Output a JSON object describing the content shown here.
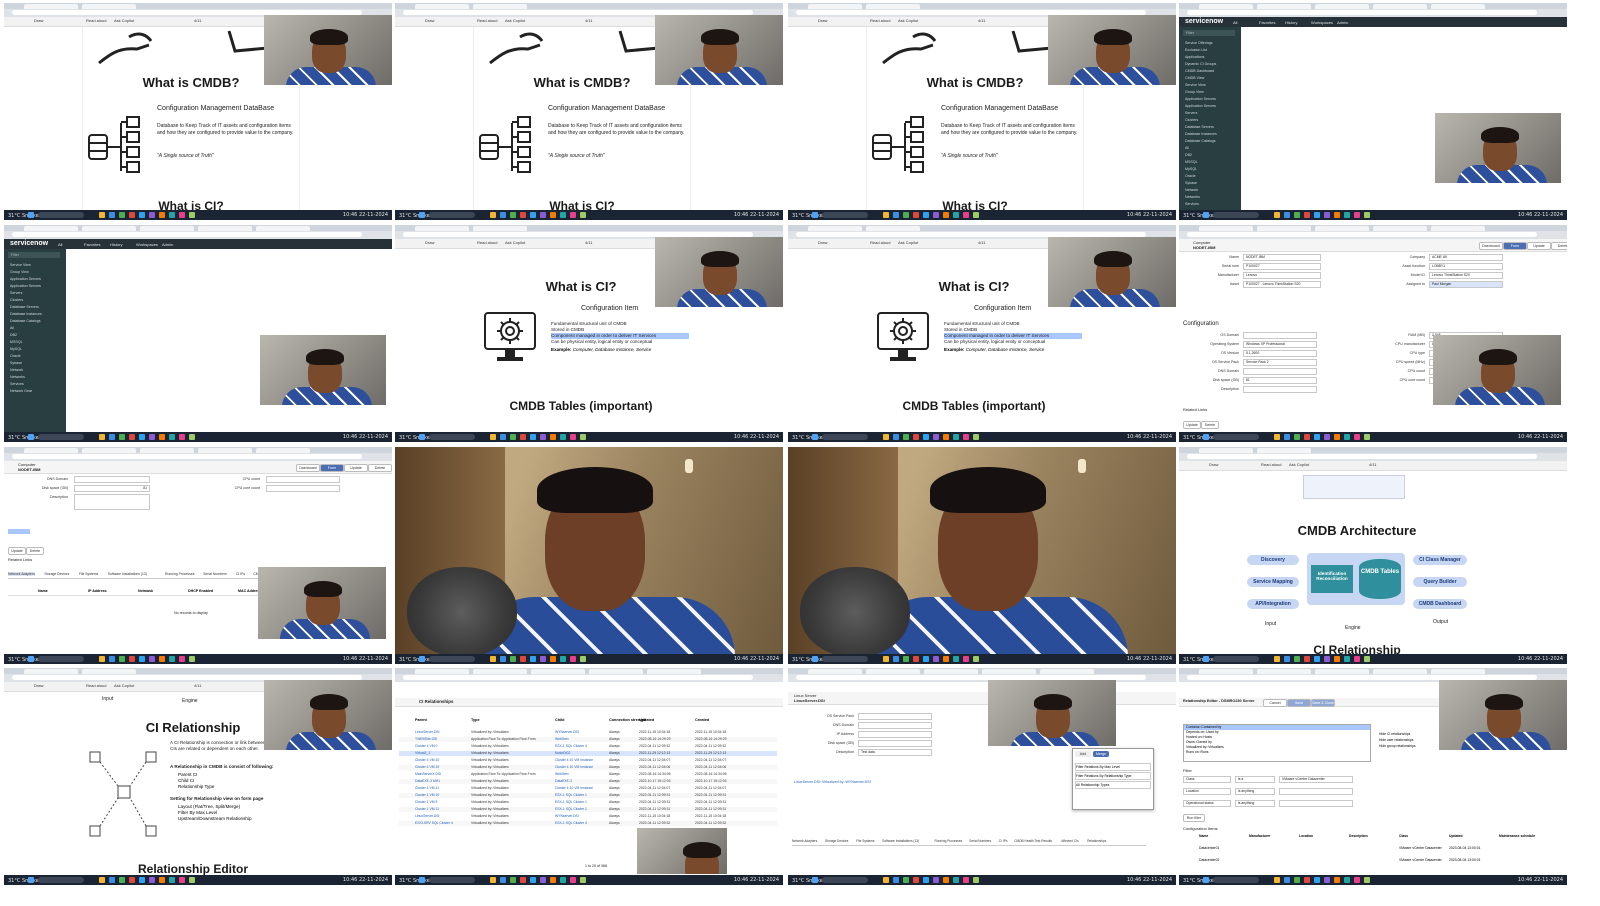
{
  "taskbar": {
    "time": "10:46",
    "date": "22-11-2024",
    "weather": "31°C Smoke",
    "search": "Search"
  },
  "pdf": {
    "ask_copilot": "Ask Copilot",
    "read_aloud": "Read aloud",
    "draw": "Draw",
    "page": "4/11"
  },
  "slides": {
    "cmdb": {
      "title": "What is CMDB?",
      "heading": "Configuration Management DataBase",
      "body": "Database to Keep Track of IT assets and configuration items and how they are configured to provide value to the company.",
      "quote": "\"A Single source of Truth\"",
      "next_title": "What is CI?"
    },
    "ci": {
      "title": "What is CI?",
      "heading": "Configuration Item",
      "bullets": [
        "Fundamental structural unit of CMDB",
        "Stored in CMDB",
        "Component managed in order to deliver IT Services",
        "Can be physical entity, logical entity or conceptual"
      ],
      "example_label": "Example:",
      "example": "Computer, Database Instance, Service",
      "next_title": "CMDB Tables (important)"
    },
    "arch": {
      "title": "CMDB Architecture",
      "left": [
        "Discovery",
        "Service Mapping",
        "API/Integration"
      ],
      "middle": [
        "Identification Reconciliation",
        "CMDB Tables"
      ],
      "right": [
        "CI Class Manager",
        "Query Builder",
        "CMDB Dashboard"
      ],
      "input": "Input",
      "engine": "Engine",
      "output": "Output",
      "next_title": "CI Relationship"
    },
    "rel": {
      "input": "Input",
      "engine": "Engine",
      "title": "CI Relationship",
      "intro": "A CI Relationship is connection or link between CIs. Shows how CIs are related or dependent on each other.",
      "consist_heading": "A Relationship in CMDB is consist of following:",
      "consist": [
        "Parent CI",
        "Child CI",
        "Relationship Type"
      ],
      "setting_heading": "Setting for Relationship view on form page",
      "setting": [
        "Layout (Flat/Tree, Split/Merge)",
        "Filter By Max Level",
        "Upstream/Downstream Relationship"
      ],
      "next_title": "Relationship Editor"
    }
  },
  "servicenow": {
    "logo": "servicenow",
    "menu": [
      "All",
      "Favorites",
      "History",
      "Workspaces",
      "Admin"
    ],
    "filter_placeholder": "Filter",
    "nav_items": [
      "Service Offerings",
      "Exclusion List",
      "Applications",
      "Dynamic CI Groups",
      "CMDB Dashboard",
      "CMDB View",
      "Service View",
      "Group View",
      "Application Servers",
      "Application Servers",
      "Servers",
      "Clusters",
      "Database Servers",
      "Database Instances",
      "Database Catalogs",
      "All",
      "DB2",
      "MSSQL",
      "MySQL",
      "Oracle",
      "Sybase",
      "Network",
      "Networks",
      "Services",
      "Network Gear"
    ],
    "computer_form": {
      "record_type": "Computer",
      "record_name": "NODET-IBM",
      "fields_left": [
        [
          "Name",
          "NODET-IBM"
        ],
        [
          "Serial num",
          "P100027"
        ],
        [
          "Manufacturer",
          "Lenovo"
        ],
        [
          "Asset",
          "P100027 - Lenovo ThinkStation S20"
        ]
      ],
      "fields_right": [
        [
          "Company",
          "ACME UK"
        ],
        [
          "Asset function",
          "LOBBY1"
        ],
        [
          "Model ID",
          "Lenovo ThinkStation S20"
        ],
        [
          "Assigned to",
          "Paul Morgan"
        ]
      ],
      "section": "Configuration",
      "config_left": [
        [
          "OS Domain",
          ""
        ],
        [
          "Operating System",
          "Windows XP Professional"
        ],
        [
          "OS Version",
          "5.1.2600"
        ],
        [
          "OS Service Pack",
          "Service Pack 2"
        ],
        [
          "DNS Domain",
          ""
        ],
        [
          "Disk space (GB)",
          "81"
        ],
        [
          "Description",
          ""
        ]
      ],
      "config_right": [
        [
          "RAM (MB)",
          "2,048"
        ],
        [
          "CPU manufacturer",
          "Intel"
        ],
        [
          "CPU type",
          ""
        ],
        [
          "CPU speed (MHz)",
          ""
        ],
        [
          "CPU count",
          ""
        ],
        [
          "CPU core count",
          ""
        ]
      ],
      "buttons": [
        "Dashboard",
        "Form",
        "Update",
        "Delete"
      ],
      "related": "Related Links",
      "update": "Update",
      "delete": "Delete",
      "tabs": [
        "Network Adapters",
        "Storage Devices",
        "File Systems",
        "Software Installations (13)",
        "Running Processes",
        "Serial Numbers",
        "CI IPs",
        "CMDB Health Test Results",
        "Affected CIs",
        "Relationships"
      ],
      "table_cols": [
        "Name",
        "IP Address",
        "Netmask",
        "DHCP Enabled",
        "MAC Address"
      ],
      "no_records": "No records to display"
    },
    "relationships": {
      "title": "CI Relationships",
      "columns": [
        "Parent",
        "Type",
        "Child",
        "Connection strength",
        "Updated",
        "Created"
      ],
      "rows": [
        [
          "LinuxServer.DSI",
          "Virtualized by::Virtualizes",
          "WYNserver.DSI",
          "Always",
          "2022-11-15 10:04:18",
          "2022-11-15 10:04:18"
        ],
        [
          "TWEBSite.DSI",
          "Application Flow To::Application Flow From",
          "WebServ",
          "Always",
          "2022-08-16 14:29:29",
          "2022-08-16 14:29:29"
        ],
        [
          "Cluster 4 VM 0",
          "Virtualized by::Virtualizes",
          "ESX-1 SQL Cluster 4",
          "Always",
          "2022-04-11 12:09:32",
          "2022-04-11 12:09:32"
        ],
        [
          "Virtual1_1",
          "Virtualized by::Virtualizes",
          "NodeDI02",
          "Always",
          "2022-11-29 12:12:13",
          "2022-11-29 12:12:13"
        ],
        [
          "Cluster 4 VM 10",
          "Virtualized by::Virtualizes",
          "Cluster 4 10 VM Instance",
          "Always",
          "2022-04-11 12:04:07",
          "2022-04-11 12:04:07"
        ],
        [
          "Cluster 4 VM 19",
          "Virtualized by::Virtualizes",
          "Cluster 4 10 VM Instance",
          "Always",
          "2022-04-11 12:04:06",
          "2022-04-11 12:04:06"
        ],
        [
          "MainServerX.DSI",
          "Application Flow To::Application Flow From",
          "WebServ",
          "Always",
          "2022-08-16 14:34:06",
          "2022-08-16 14:34:06"
        ],
        [
          "DataEXE-3 MH1",
          "Virtualized by::Virtualizes",
          "DataEXE-3",
          "Always",
          "2022-10-17 15:12:03",
          "2022-10-17 15:12:03"
        ],
        [
          "Cluster 4 VM 11",
          "Virtualized by::Virtualizes",
          "Cluster 4 10 VM Instance",
          "Always",
          "2022-04-11 12:04:07",
          "2022-04-11 12:04:07"
        ],
        [
          "Cluster 1 VM 10",
          "Virtualized by::Virtualizes",
          "ESX-1 SQL Cluster 1",
          "Always",
          "2022-04-11 12:09:31",
          "2022-04-11 12:09:31"
        ],
        [
          "Cluster 1 VM 9",
          "Virtualized by::Virtualizes",
          "ESX-1 SQL Cluster 1",
          "Always",
          "2022-04-11 12:09:31",
          "2022-04-11 12:09:31"
        ],
        [
          "Cluster 1 VM 11",
          "Virtualized by::Virtualizes",
          "ESX-1 SQL Cluster 1",
          "Always",
          "2022-04-11 12:09:31",
          "2022-04-11 12:09:31"
        ],
        [
          "LinuxServer.DSI",
          "Virtualized by::Virtualizes",
          "WYNserver.DSI",
          "Always",
          "2022-11-15 10:04:18",
          "2022-11-15 10:04:18"
        ],
        [
          "ESXI-SRV SQL Cluster 4",
          "Virtualized by::Virtualizes",
          "ESX-1 SQL Cluster 4",
          "Always",
          "2022-04-11 12:09:32",
          "2022-04-11 12:09:32"
        ]
      ],
      "pager": "1 to 20 of 368"
    },
    "linux_form": {
      "record_type": "Linux Server",
      "record_name": "LinuxServer.DSI",
      "fields": [
        [
          "OS Service Pack",
          ""
        ],
        [
          "DNS Domain",
          ""
        ],
        [
          "IP Address",
          ""
        ],
        [
          "Disk space (GB)",
          ""
        ],
        [
          "Description",
          "Test data"
        ]
      ],
      "related_items": [
        "LinuxServer.DSI::Virtualized by::WYNserver.DSI"
      ],
      "popup_buttons": [
        "Add",
        "Merge"
      ],
      "popup_options": [
        "Filter Relations By Max Level",
        "Filter Relations By Relationship Type",
        "All Relationship Types"
      ]
    },
    "rel_editor": {
      "title": "Relationship Editor - DSMRO230 Server",
      "buttons": [
        "Cancel",
        "Save",
        "Save & Close"
      ],
      "types": [
        "Contains::Contained by",
        "Depends on::Used by",
        "Hosted on::Hosts",
        "Owns::Owned by",
        "Virtualized by::Virtualizes",
        "Runs on::Runs"
      ],
      "options": [
        "Hide CI relationships",
        "Hide user relationships",
        "Hide group relationships"
      ],
      "filter_label": "Filter",
      "filter_rows": [
        [
          "Class",
          "is a",
          "VMware vCenter Datacenter"
        ],
        [
          "Location",
          "is anything",
          ""
        ],
        [
          "Operational status",
          "is anything",
          ""
        ]
      ],
      "run_filter": "Run filter",
      "ci_label": "Configuration Items",
      "ci_columns": [
        "Name",
        "Manufacturer",
        "Location",
        "Description",
        "Class",
        "Updated",
        "Maintenance schedule"
      ],
      "ci_rows": [
        [
          "Datacenter01",
          "",
          "",
          "",
          "VMware vCenter Datacenter",
          "2023-08-04 13:00:01",
          ""
        ],
        [
          "Datacenter02",
          "",
          "",
          "",
          "VMware vCenter Datacenter",
          "2023-08-04 13:00:01",
          ""
        ]
      ]
    }
  },
  "colors": {
    "taskbar": "#1b2433",
    "servicenow_header": "#263238",
    "servicenow_nav": "#293e40",
    "arch_box": "#c6d6f3",
    "arch_center": "#2f8f9d",
    "highlight": "#a8c6ff",
    "shirt_blue": "#2d4f9c"
  },
  "icons": [
    "database-tree-icon",
    "computer-gear-icon",
    "hand-icon",
    "windows-start-icon",
    "microphone",
    "webcam-person"
  ]
}
